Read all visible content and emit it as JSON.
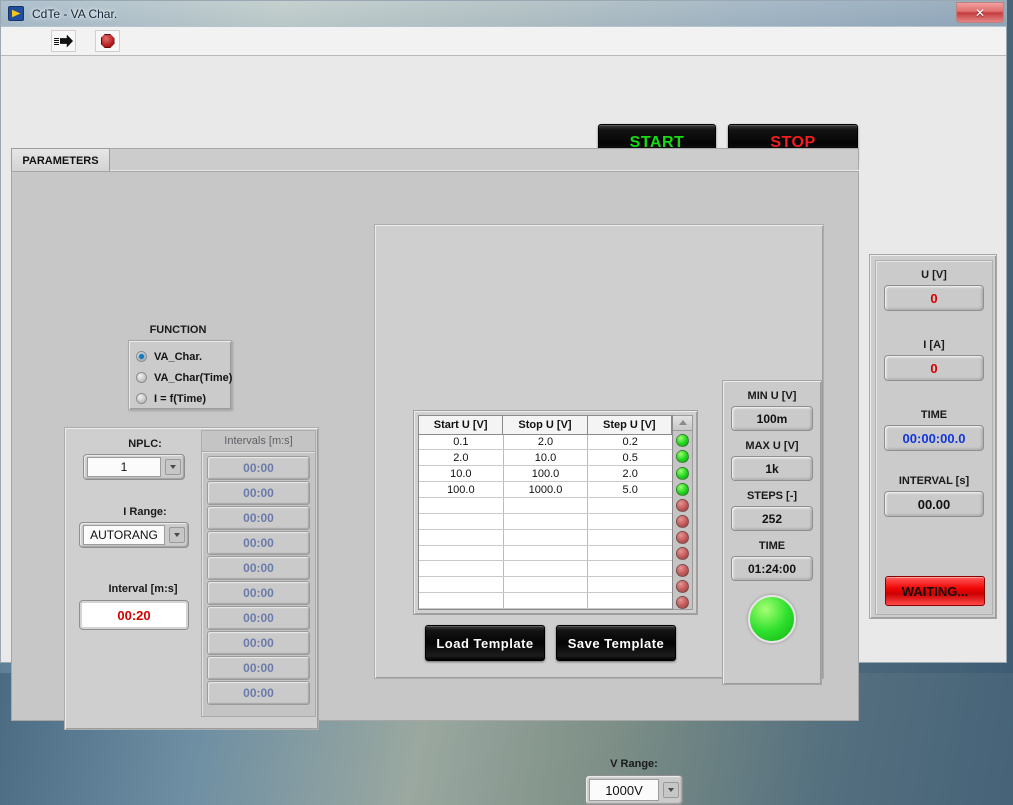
{
  "window": {
    "title": "CdTe - VA Char.",
    "app_icon": "labview-icon",
    "close_label": "✕"
  },
  "toolbar": {
    "run_icon": "run-arrow-icon",
    "abort_icon": "abort-stop-icon"
  },
  "top_buttons": {
    "start": "START",
    "stop": "STOP",
    "start_color": "#14dd14",
    "stop_color": "#f51d1d"
  },
  "tabs": [
    {
      "label": "PARAMETERS",
      "selected": true
    }
  ],
  "function": {
    "title": "FUNCTION",
    "options": [
      {
        "label": "VA_Char.",
        "selected": true
      },
      {
        "label": "VA_Char(Time)",
        "selected": false
      },
      {
        "label": "I = f(Time)",
        "selected": false
      }
    ]
  },
  "left_panel": {
    "nplc_label": "NPLC:",
    "nplc_value": "1",
    "irange_label": "I Range:",
    "irange_value": "AUTORANG",
    "interval_label": "Interval [m:s]",
    "interval_value": "00:20",
    "interval_color": "#d40000",
    "intervals_header": "Intervals [m:s]",
    "intervals": [
      "00:00",
      "00:00",
      "00:00",
      "00:00",
      "00:00",
      "00:00",
      "00:00",
      "00:00",
      "00:00",
      "00:00"
    ]
  },
  "table": {
    "columns": [
      "Start U [V]",
      "Stop U [V]",
      "Step U [V]"
    ],
    "rows": [
      [
        "0.1",
        "2.0",
        "0.2"
      ],
      [
        "2.0",
        "10.0",
        "0.5"
      ],
      [
        "10.0",
        "100.0",
        "2.0"
      ],
      [
        "100.0",
        "1000.0",
        "5.0"
      ],
      [
        "",
        "",
        ""
      ],
      [
        "",
        "",
        ""
      ],
      [
        "",
        "",
        ""
      ],
      [
        "",
        "",
        ""
      ],
      [
        "",
        "",
        ""
      ],
      [
        "",
        "",
        ""
      ],
      [
        "",
        "",
        ""
      ]
    ],
    "leds": [
      true,
      true,
      true,
      true,
      false,
      false,
      false,
      false,
      false,
      false,
      false
    ]
  },
  "template_buttons": {
    "load": "Load Template",
    "save": "Save Template"
  },
  "stats": {
    "min_u_label": "MIN U [V]",
    "min_u_value": "100m",
    "max_u_label": "MAX U [V]",
    "max_u_value": "1k",
    "steps_label": "STEPS [-]",
    "steps_value": "252",
    "time_label": "TIME",
    "time_value": "01:24:00",
    "indicator": "green-led-indicator"
  },
  "vrange": {
    "label": "V Range:",
    "value": "1000V"
  },
  "monitor": {
    "u_label": "U [V]",
    "u_value": "0",
    "u_color": "#d40000",
    "i_label": "I [A]",
    "i_value": "0",
    "i_color": "#d40000",
    "time_label": "TIME",
    "time_value": "00:00:00.0",
    "time_color": "#1335dd",
    "interval_label": "INTERVAL [s]",
    "interval_value": "00.00",
    "interval_color": "#111111",
    "status": "WAITING..."
  }
}
